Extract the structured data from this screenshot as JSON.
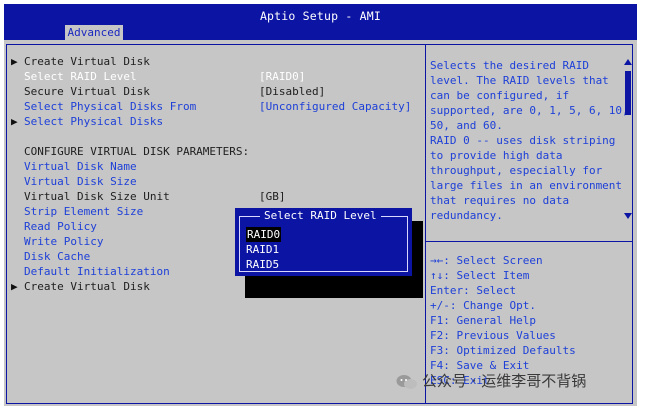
{
  "window": {
    "title": "Aptio Setup - AMI"
  },
  "tabs": [
    {
      "label": "Advanced"
    }
  ],
  "menu": [
    {
      "label": "Create Virtual Disk",
      "submenu": true,
      "value": ""
    },
    {
      "label": "Select RAID Level",
      "submenu": false,
      "value": "[RAID0]"
    },
    {
      "label": "Secure Virtual Disk",
      "submenu": false,
      "value": "[Disabled]"
    },
    {
      "label": "Select Physical Disks From",
      "submenu": false,
      "value": "[Unconfigured Capacity]"
    },
    {
      "label": "Select Physical Disks",
      "submenu": true,
      "value": ""
    },
    {
      "label": "",
      "submenu": false,
      "value": ""
    },
    {
      "label": "CONFIGURE VIRTUAL DISK PARAMETERS:",
      "submenu": false,
      "value": ""
    },
    {
      "label": "Virtual Disk Name",
      "submenu": false,
      "value": ""
    },
    {
      "label": "Virtual Disk Size",
      "submenu": false,
      "value": ""
    },
    {
      "label": "Virtual Disk Size Unit",
      "submenu": false,
      "value": "[GB]"
    },
    {
      "label": "Strip Element Size",
      "submenu": false,
      "value": ""
    },
    {
      "label": "Read Policy",
      "submenu": false,
      "value": ""
    },
    {
      "label": "Write Policy",
      "submenu": false,
      "value": ""
    },
    {
      "label": "Disk Cache",
      "submenu": false,
      "value": ""
    },
    {
      "label": "Default Initialization",
      "submenu": false,
      "value": ""
    },
    {
      "label": "Create Virtual Disk",
      "submenu": true,
      "value": ""
    }
  ],
  "help_text": [
    "Selects the desired RAID",
    "level. The RAID levels that",
    "can be configured, if",
    "supported, are 0, 1, 5, 6, 10,",
    "50, and 60.",
    "RAID 0 -- uses disk striping",
    "to provide high data",
    "throughput, especially for",
    "large files in an environment",
    "that requires no data",
    "redundancy."
  ],
  "key_help": [
    "→←: Select Screen",
    "↑↓: Select Item",
    "Enter: Select",
    "+/-: Change Opt.",
    "F1: General Help",
    "F2: Previous Values",
    "F3: Optimized Defaults",
    "F4: Save & Exit",
    "ESC: Exit"
  ],
  "popup": {
    "title": "Select RAID Level",
    "options": [
      "RAID0",
      "RAID1",
      "RAID5"
    ],
    "selected": "RAID0"
  },
  "watermark": {
    "text": "公众号 · 运维李哥不背锅"
  },
  "colors": {
    "header": "#0b14a3",
    "panel": "#c6c6c6",
    "text_blue": "#1e40d8"
  }
}
